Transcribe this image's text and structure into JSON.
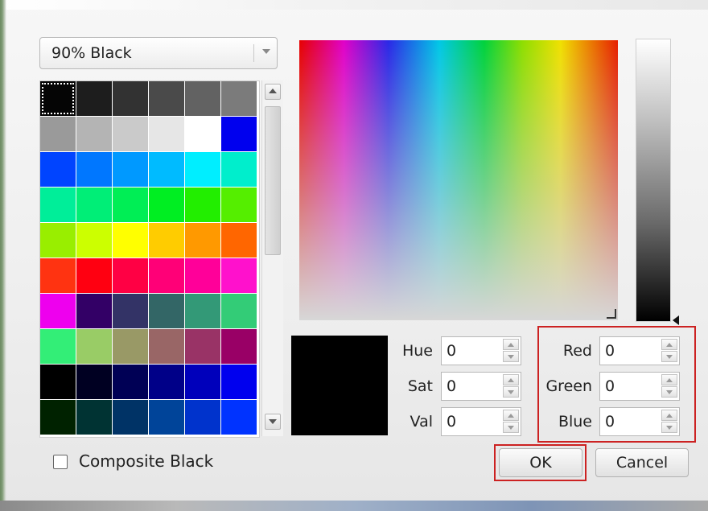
{
  "preset": {
    "selected": "90% Black"
  },
  "composite_black": {
    "label": "Composite Black",
    "checked": false
  },
  "swatches": [
    "#050505",
    "#1d1d1d",
    "#323232",
    "#4a4a4a",
    "#626262",
    "#7b7b7b",
    "#9a9a9a",
    "#b4b4b4",
    "#cacaca",
    "#e6e6e6",
    "#ffffff",
    "#0000ee",
    "#0044ff",
    "#0077ff",
    "#0099ff",
    "#00bbff",
    "#00eeff",
    "#00eecc",
    "#00ee99",
    "#00ee77",
    "#00ee55",
    "#00ee22",
    "#22ee00",
    "#55ee00",
    "#99ee00",
    "#ccff00",
    "#ffff00",
    "#ffcc00",
    "#ff9900",
    "#ff6600",
    "#ff3311",
    "#ff0011",
    "#ff0044",
    "#ff0077",
    "#ff0099",
    "#ff11cc",
    "#ee00ee",
    "#330066",
    "#333366",
    "#336666",
    "#339977",
    "#33cc77",
    "#33ee77",
    "#99cc66",
    "#999966",
    "#996666",
    "#993366",
    "#990066",
    "#000000",
    "#000022",
    "#000055",
    "#000088",
    "#0000bb",
    "#0000ee",
    "#002200",
    "#003333",
    "#003366",
    "#004499",
    "#0033cc",
    "#0033ff"
  ],
  "selected_swatch": 0,
  "preview_color": "#000000",
  "hsv": [
    {
      "label": "Hue",
      "value": "0"
    },
    {
      "label": "Sat",
      "value": "0"
    },
    {
      "label": "Val",
      "value": "0"
    }
  ],
  "rgb": [
    {
      "label": "Red",
      "value": "0"
    },
    {
      "label": "Green",
      "value": "0"
    },
    {
      "label": "Blue",
      "value": "0"
    }
  ],
  "buttons": {
    "ok": "OK",
    "cancel": "Cancel"
  },
  "highlight_color": "#cc2222"
}
